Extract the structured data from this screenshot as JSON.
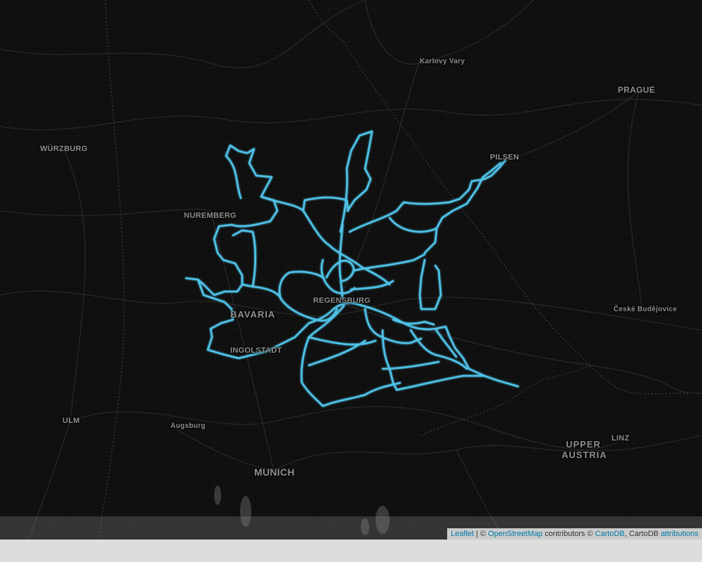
{
  "map": {
    "labels": {
      "karlovy_vary": "Karlovy Vary",
      "prague": "PRAGUE",
      "wurzburg": "WÜRZBURG",
      "pilsen": "PILSEN",
      "nuremberg": "NUREMBERG",
      "regensburg": "REGENSBURG",
      "bavaria": "BAVARIA",
      "ingolstadt": "INGOLSTADT",
      "ceske_budejovice": "České Budějovice",
      "ulm": "ULM",
      "augsburg": "Augsburg",
      "upper_austria": "UPPER AUSTRIA",
      "linz": "LINZ",
      "munich": "MUNICH"
    },
    "track_color": "#4fc3e8",
    "base_color": "#0f0f0f"
  },
  "attribution": {
    "leaflet": "Leaflet",
    "sep": " | © ",
    "osm": "OpenStreetMap",
    "contributors": " contributors © ",
    "cartodb": "CartoDB",
    "cartodb_plain": ", CartoDB ",
    "attributions": "attributions"
  }
}
